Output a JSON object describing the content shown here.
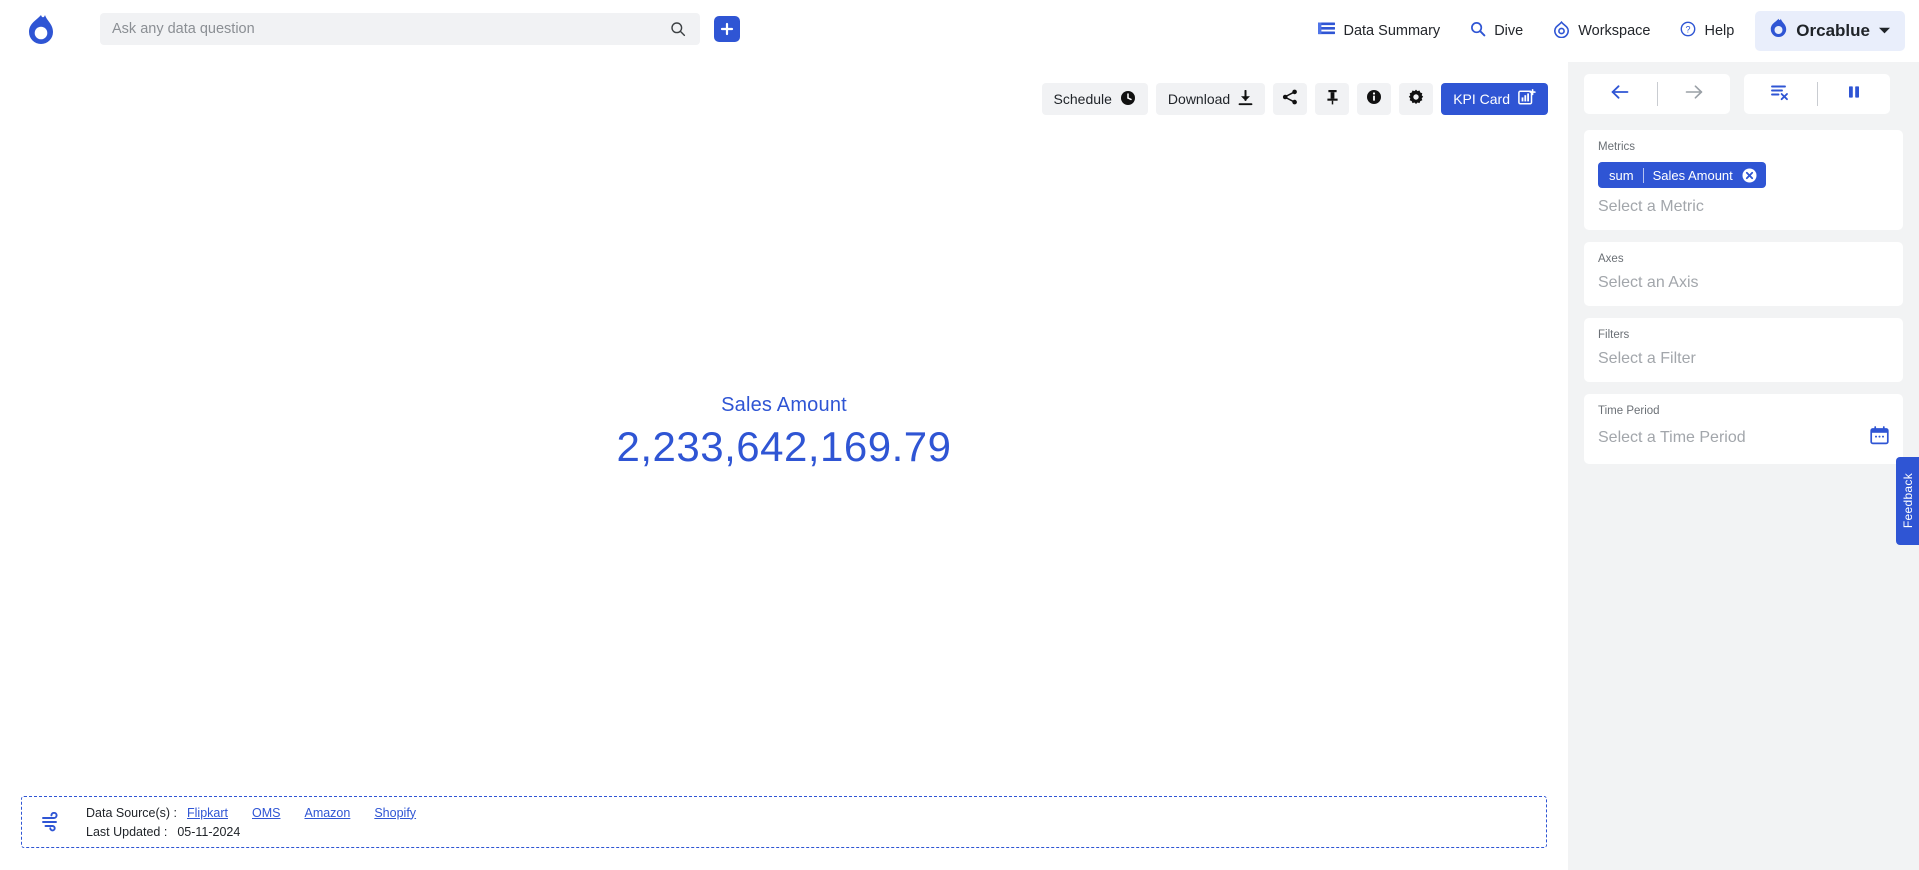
{
  "app": {
    "brand_name": "Orcablue",
    "accent_color": "#2f55d4",
    "logo_icon": "orca-droplet-logo"
  },
  "search": {
    "placeholder": "Ask any data question",
    "value": "",
    "search_icon": "search-icon",
    "add_icon": "plus-icon"
  },
  "nav": {
    "items": [
      {
        "label": "Data Summary",
        "icon": "list-bars-icon"
      },
      {
        "label": "Dive",
        "icon": "search-icon"
      },
      {
        "label": "Workspace",
        "icon": "workspace-orca-icon"
      },
      {
        "label": "Help",
        "icon": "question-circle-icon"
      }
    ],
    "account": {
      "label": "Orcablue",
      "icon": "orca-droplet-logo",
      "caret": "chevron-down-icon"
    }
  },
  "toolbar": {
    "schedule_label": "Schedule",
    "schedule_icon": "clock-icon",
    "download_label": "Download",
    "download_icon": "download-icon",
    "share_icon": "share-icon",
    "pin_icon": "pin-icon",
    "info_icon": "info-icon",
    "settings_icon": "gear-icon",
    "kpi_label": "KPI Card",
    "kpi_icon": "kpi-chart-plus-icon"
  },
  "kpi": {
    "label": "Sales Amount",
    "value": "2,233,642,169.79"
  },
  "footer": {
    "icon": "wind-flow-icon",
    "sources_label": "Data Source(s) :",
    "sources": [
      "Flipkart",
      "OMS",
      "Amazon",
      "Shopify"
    ],
    "last_updated_label": "Last Updated :",
    "last_updated_value": "05-11-2024"
  },
  "sidebar": {
    "toolbar": {
      "back_icon": "arrow-left-icon",
      "forward_icon": "arrow-right-icon",
      "clear_filters_icon": "clear-filters-icon",
      "pause_icon": "pause-icon"
    },
    "metrics": {
      "title": "Metrics",
      "chip_agg": "sum",
      "chip_field": "Sales Amount",
      "chip_remove_icon": "close-circle-icon",
      "placeholder": "Select a Metric"
    },
    "axes": {
      "title": "Axes",
      "placeholder": "Select an Axis"
    },
    "filters": {
      "title": "Filters",
      "placeholder": "Select a Filter"
    },
    "time_period": {
      "title": "Time Period",
      "placeholder": "Select a Time Period",
      "calendar_icon": "calendar-icon"
    }
  },
  "feedback": {
    "label": "Feedback"
  },
  "chart_data": {
    "type": "table",
    "title": "Sales Amount",
    "categories": [
      "Sales Amount"
    ],
    "values": [
      2233642169.79
    ],
    "value_labels": [
      "2,233,642,169.79"
    ],
    "xlabel": "",
    "ylabel": "",
    "aggregation": "sum",
    "legend": [],
    "grid": false
  }
}
